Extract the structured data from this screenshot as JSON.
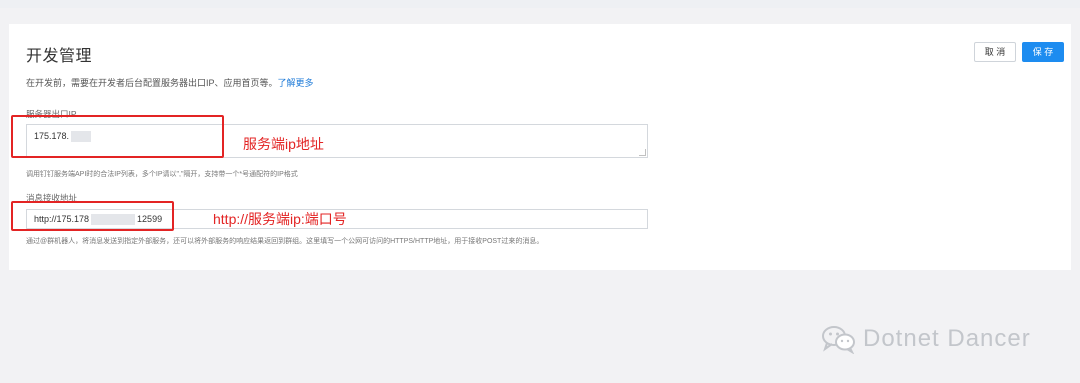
{
  "header": {
    "title": "开发管理",
    "intro_text": "在开发前，需要在开发者后台配置服务器出口IP、应用首页等。",
    "learn_more": "了解更多"
  },
  "actions": {
    "cancel_label": "取 消",
    "save_label": "保 存"
  },
  "server_ip": {
    "label": "服务器出口IP",
    "value_prefix": "175.178.",
    "help": "调用钉钉服务端API时的合法IP列表，多个IP请以\",\"隔开，支持带一个*号通配符的IP格式"
  },
  "callback_url": {
    "label": "消息接收地址",
    "value_prefix": "http://175.178",
    "value_suffix": "12599",
    "help": "通过@群机器人，将消息发送到指定外部服务，还可以将外部服务的响应结果返回到群组。这里填写一个公网可访问的HTTPS/HTTP地址，用于接收POST过来的消息。"
  },
  "annotations": {
    "ip_note": "服务端ip地址",
    "url_note": "http://服务端ip:端口号"
  },
  "watermark": {
    "text": "Dotnet Dancer",
    "icon": "wechat-icon"
  },
  "colors": {
    "primary": "#1d8cf0",
    "annotation": "#e32424",
    "link": "#1f7bd8"
  }
}
